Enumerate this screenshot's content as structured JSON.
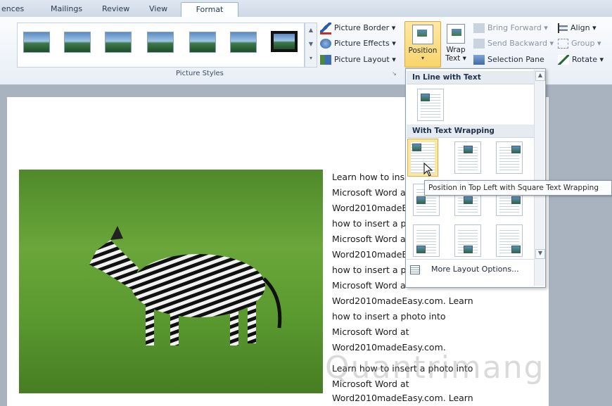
{
  "tabs": [
    "ences",
    "Mailings",
    "Review",
    "View",
    "Format"
  ],
  "picture_styles": {
    "group_label": "Picture Styles",
    "thumbnail_count": 7,
    "commands": [
      "Picture Border",
      "Picture Effects",
      "Picture Layout"
    ]
  },
  "arrange": {
    "position_label": "Position",
    "wrap_label_1": "Wrap",
    "wrap_label_2": "Text",
    "commands": [
      "Bring Forward",
      "Send Backward",
      "Selection Pane"
    ],
    "right_commands": [
      "Align",
      "Group",
      "Rotate"
    ]
  },
  "document_lines": [
    "Learn how to ins",
    "Microsoft Word a",
    "Word2010madeE",
    "how to insert a p",
    "Microsoft Word a",
    "Word2010madeE",
    "how to insert a p",
    "Microsoft Word a",
    "Word2010madeEasy.com.  Learn",
    "how to insert a photo into",
    "Microsoft Word at",
    "Word2010madeEasy.com.",
    "Learn how to insert a photo into",
    "Microsoft Word at",
    "Word2010madeEasy.com.  Learn"
  ],
  "dropdown": {
    "section_inline": "In Line with Text",
    "section_wrapping": "With Text Wrapping",
    "more_options": "More Layout Options...",
    "tooltip": "Position in Top Left with Square Text Wrapping"
  },
  "watermark": "Quantrimang"
}
